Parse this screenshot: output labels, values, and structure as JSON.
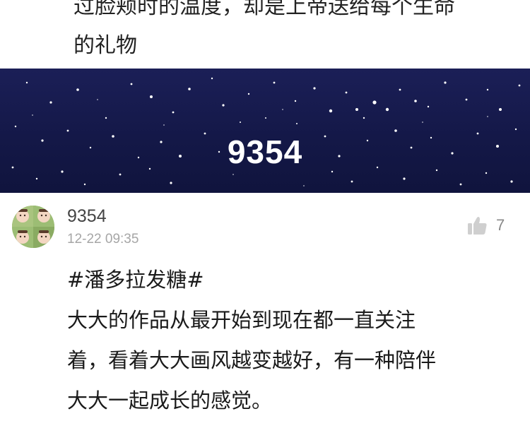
{
  "previous_comment": {
    "lines": [
      "过脸颊时的温度，却是上帝送给每个生命",
      "的礼物"
    ]
  },
  "banner": {
    "title": "9354",
    "background_color": "#141848"
  },
  "comment": {
    "avatar_icon": "avatar-photo",
    "username": "9354",
    "timestamp": "12-22 09:35",
    "like_icon": "thumbs-up-icon",
    "like_count": "7",
    "lines": [
      "#潘多拉发糖#",
      "大大的作品从最开始到现在都一直关注",
      "着，看着大大画风越变越好，有一种陪伴",
      "大大一起成长的感觉。"
    ]
  }
}
